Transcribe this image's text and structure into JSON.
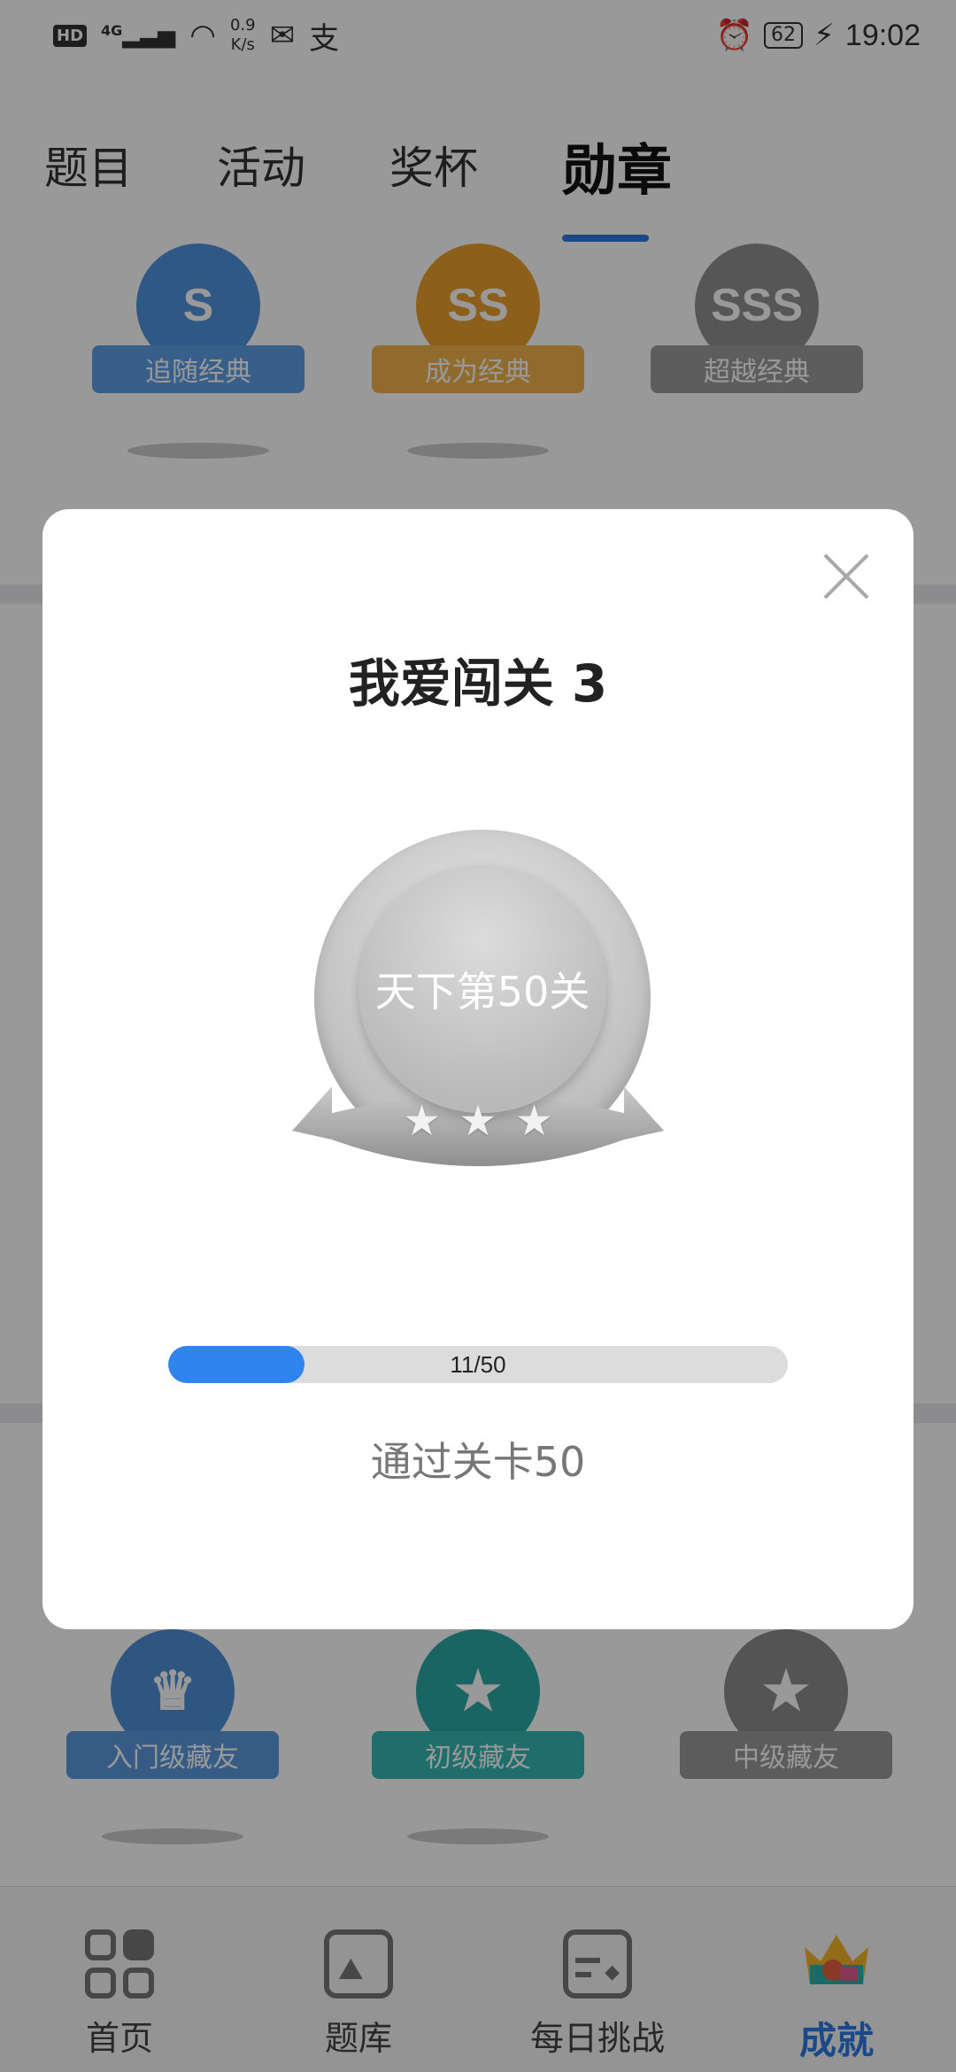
{
  "status_bar": {
    "hd": "HD",
    "signal": "4G",
    "speed_value": "0.9",
    "speed_unit": "K/s",
    "battery": "62",
    "time": "19:02"
  },
  "tabs": [
    {
      "label": "题目"
    },
    {
      "label": "活动"
    },
    {
      "label": "奖杯"
    },
    {
      "label": "勋章"
    }
  ],
  "top_medals": [
    {
      "label": "追随经典",
      "grade": "S",
      "color": "#4f93dd"
    },
    {
      "label": "成为经典",
      "grade": "SS",
      "color": "#e9a12e"
    },
    {
      "label": "超越经典",
      "grade": "SSS",
      "color": "#8f8f8f"
    }
  ],
  "bottom_medals": [
    {
      "label": "入门级藏友",
      "color": "#4f8ed8"
    },
    {
      "label": "初级藏友",
      "color": "#2aa9a5"
    },
    {
      "label": "中级藏友",
      "color": "#8c8c8c"
    }
  ],
  "dialog": {
    "title": "我爱闯关 3",
    "badge_text": "天下第50关",
    "stars": 3,
    "progress_current": 11,
    "progress_total": 50,
    "progress_label": "11/50",
    "description": "通过关卡50"
  },
  "bottom_nav": [
    {
      "label": "首页",
      "icon": "grid-icon"
    },
    {
      "label": "题库",
      "icon": "gallery-icon"
    },
    {
      "label": "每日挑战",
      "icon": "calendar-icon"
    },
    {
      "label": "成就",
      "icon": "crown-icon"
    }
  ],
  "colors": {
    "accent": "#2c7be5",
    "progress_fill": "#2f84ee"
  }
}
